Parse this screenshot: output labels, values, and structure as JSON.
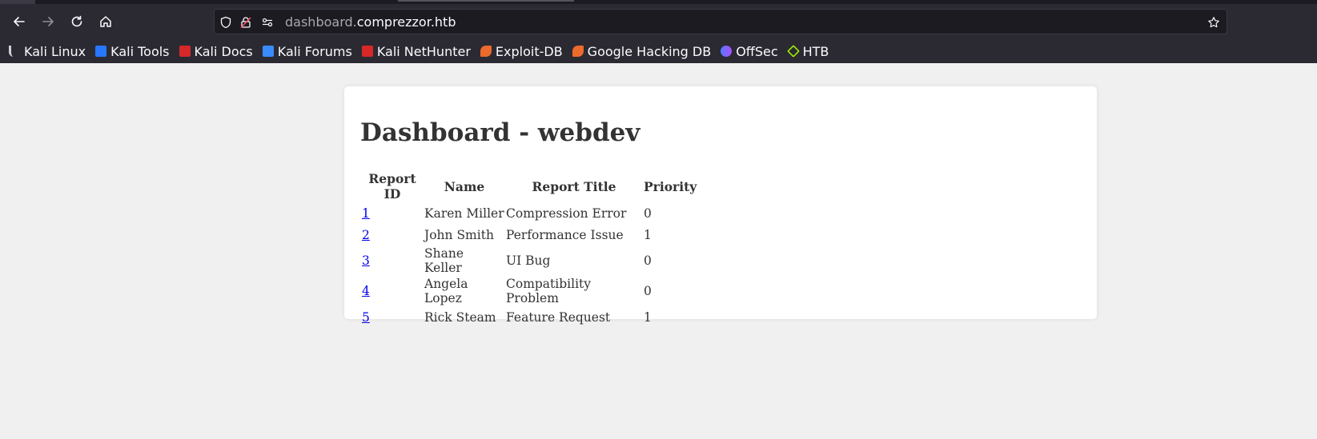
{
  "browser": {
    "url_subdomain": "dashboard.",
    "url_domain": "comprezzor.htb",
    "bookmarks": [
      {
        "label": "Kali Linux",
        "icon": "kali-dragon-icon",
        "color": "#1b1b1b"
      },
      {
        "label": "Kali Tools",
        "icon": "kali-tools-icon",
        "color": "#2777ff"
      },
      {
        "label": "Kali Docs",
        "icon": "kali-docs-icon",
        "color": "#d62828"
      },
      {
        "label": "Kali Forums",
        "icon": "kali-forums-icon",
        "color": "#3a8bff"
      },
      {
        "label": "Kali NetHunter",
        "icon": "kali-nethunter-icon",
        "color": "#d62828"
      },
      {
        "label": "Exploit-DB",
        "icon": "exploit-db-icon",
        "color": "#ec6a2c"
      },
      {
        "label": "Google Hacking DB",
        "icon": "ghdb-icon",
        "color": "#ec6a2c"
      },
      {
        "label": "OffSec",
        "icon": "offsec-icon",
        "color": "#4f7bff"
      },
      {
        "label": "HTB",
        "icon": "htb-icon",
        "color": "#9fef00"
      }
    ]
  },
  "dashboard": {
    "title": "Dashboard - webdev",
    "columns": [
      "Report ID",
      "Name",
      "Report Title",
      "Priority"
    ],
    "rows": [
      {
        "id": "1",
        "name": "Karen Miller",
        "title": "Compression Error",
        "priority": "0"
      },
      {
        "id": "2",
        "name": "John Smith",
        "title": "Performance Issue",
        "priority": "1"
      },
      {
        "id": "3",
        "name": "Shane Keller",
        "title": "UI Bug",
        "priority": "0"
      },
      {
        "id": "4",
        "name": "Angela Lopez",
        "title": "Compatibility Problem",
        "priority": "0"
      },
      {
        "id": "5",
        "name": "Rick Steam",
        "title": "Feature Request",
        "priority": "1"
      }
    ]
  }
}
